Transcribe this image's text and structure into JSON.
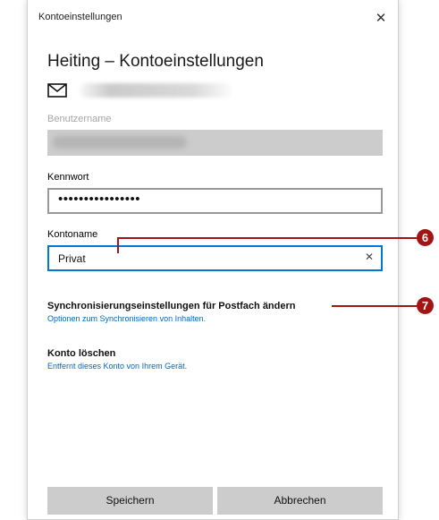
{
  "window": {
    "title": "Kontoeinstellungen",
    "close_glyph": "✕"
  },
  "heading": "Heiting – Kontoeinstellungen",
  "icons": {
    "mail": "envelope-icon",
    "clear": "clear-icon",
    "close": "close-icon"
  },
  "username": {
    "label": "Benutzername"
  },
  "password": {
    "label": "Kennwort",
    "value": "••••••••••••••••"
  },
  "account_name": {
    "label": "Kontoname",
    "value": "Privat",
    "clear_glyph": "✕"
  },
  "sync": {
    "title": "Synchronisierungseinstellungen für Postfach ändern",
    "subtitle": "Optionen zum Synchronisieren von Inhalten."
  },
  "delete": {
    "title": "Konto löschen",
    "subtitle": "Entfernt dieses Konto von Ihrem Gerät."
  },
  "buttons": {
    "save": "Speichern",
    "cancel": "Abbrechen"
  },
  "markers": {
    "account_name": "6",
    "sync": "7"
  },
  "colors": {
    "accent": "#0078d7",
    "link": "#0067c0",
    "marker": "#a31515"
  }
}
